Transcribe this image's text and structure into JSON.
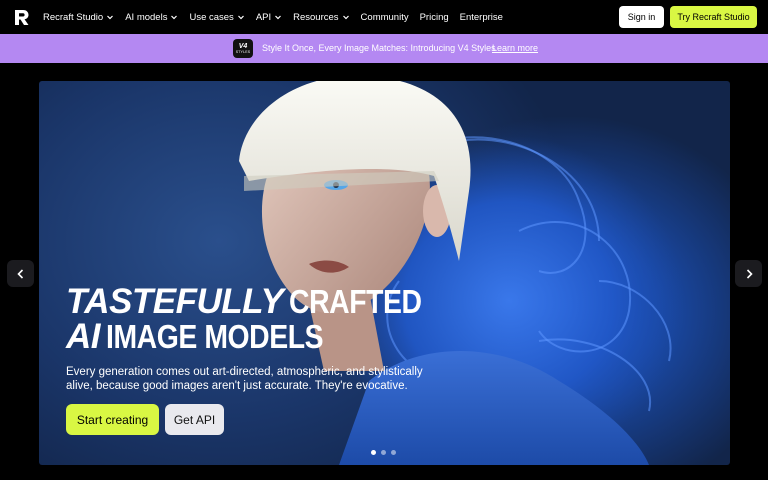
{
  "nav": {
    "items": [
      {
        "label": "Recraft Studio",
        "dropdown": true
      },
      {
        "label": "AI models",
        "dropdown": true
      },
      {
        "label": "Use cases",
        "dropdown": true
      },
      {
        "label": "API",
        "dropdown": true
      },
      {
        "label": "Resources",
        "dropdown": true
      },
      {
        "label": "Community",
        "dropdown": false
      },
      {
        "label": "Pricing",
        "dropdown": false
      },
      {
        "label": "Enterprise",
        "dropdown": false
      }
    ],
    "signin_label": "Sign in",
    "try_label": "Try Recraft Studio"
  },
  "banner": {
    "badge_top": "V4",
    "badge_bottom": "STYLES",
    "text": "Style It Once, Every Image Matches: Introducing V4 Styles",
    "link": "Learn more"
  },
  "hero": {
    "line1_italic": "TASTEFULLY",
    "line1_bold": "CRAFTED",
    "line2_italic": "AI",
    "line2_bold": "IMAGE MODELS",
    "subtitle": "Every generation comes out art-directed, atmospheric, and stylistically alive, because good images aren't just accurate. They're evocative.",
    "primary_button": "Start creating",
    "secondary_button": "Get API",
    "slide_count": 3,
    "active_slide": 1
  },
  "colors": {
    "accent": "#d9f743",
    "banner": "#b488f2",
    "background": "#000000"
  }
}
